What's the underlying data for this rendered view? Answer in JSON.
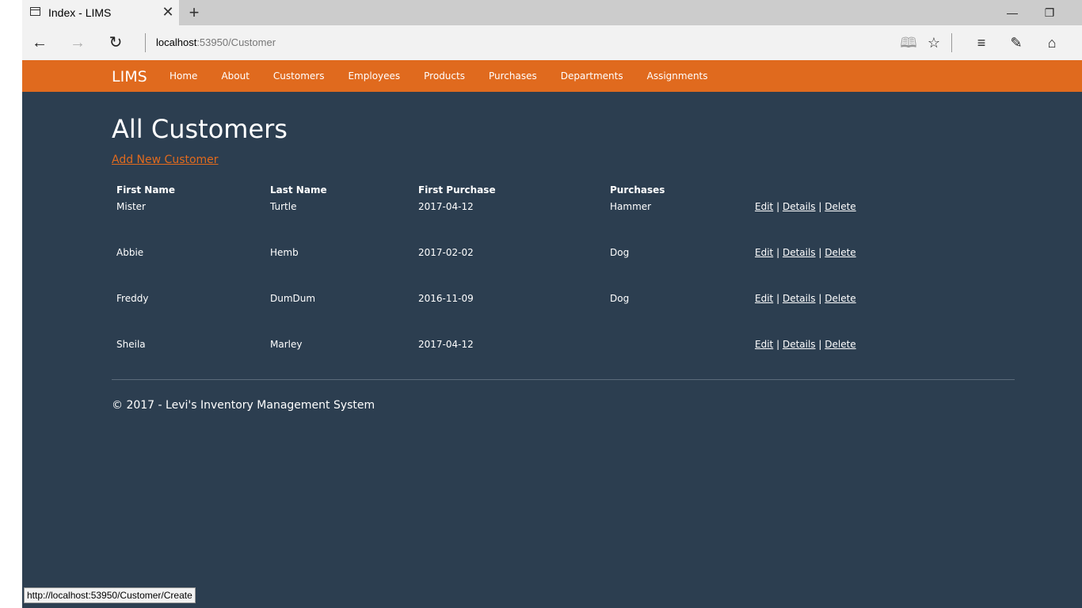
{
  "browser": {
    "tab_title": "Index - LIMS",
    "tab_close": "✕",
    "new_tab": "+",
    "url_host": "localhost",
    "url_path": ":53950/Customer",
    "status_url": "http://localhost:53950/Customer/Create"
  },
  "navbar": {
    "brand": "LIMS",
    "links": [
      "Home",
      "About",
      "Customers",
      "Employees",
      "Products",
      "Purchases",
      "Departments",
      "Assignments"
    ]
  },
  "main": {
    "title": "All Customers",
    "add_link": "Add New Customer",
    "columns": [
      "First Name",
      "Last Name",
      "First Purchase",
      "Purchases"
    ],
    "rows": [
      {
        "first": "Mister",
        "last": "Turtle",
        "first_purchase": "2017-04-12",
        "purchases": "Hammer"
      },
      {
        "first": "Abbie",
        "last": "Hemb",
        "first_purchase": "2017-02-02",
        "purchases": "Dog"
      },
      {
        "first": "Freddy",
        "last": "DumDum",
        "first_purchase": "2016-11-09",
        "purchases": "Dog"
      },
      {
        "first": "Sheila",
        "last": "Marley",
        "first_purchase": "2017-04-12",
        "purchases": ""
      }
    ],
    "actions": {
      "edit": "Edit",
      "details": "Details",
      "delete": "Delete",
      "sep": "|"
    }
  },
  "footer": {
    "text": "© 2017 - Levi's Inventory Management System"
  },
  "colors": {
    "accent": "#e06a1e",
    "background": "#2c3e50"
  }
}
